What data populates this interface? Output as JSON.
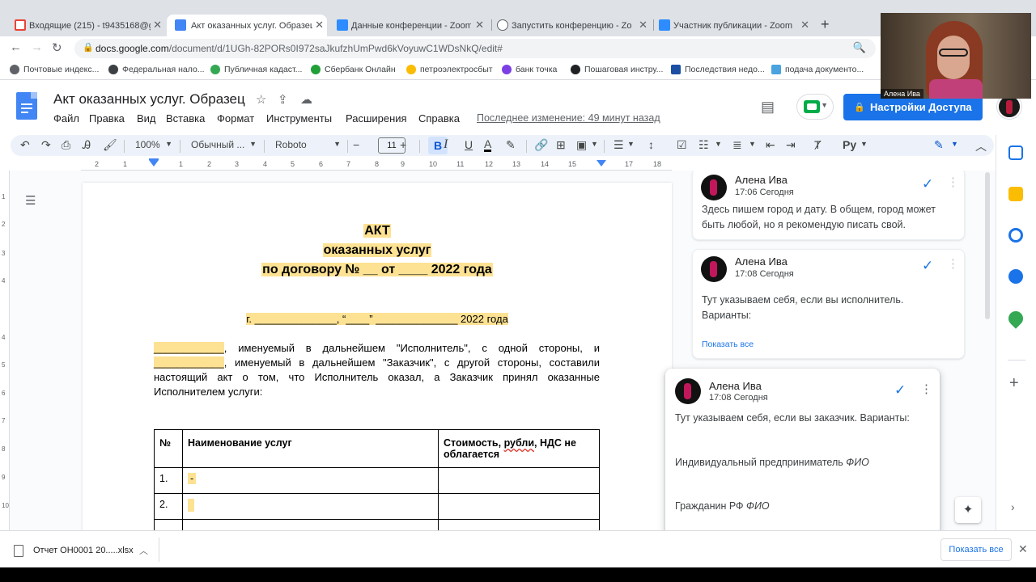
{
  "browser": {
    "tabs": [
      {
        "title": "Входящие (215) - t9435168@gm",
        "color": "#ea4335"
      },
      {
        "title": "Акт оказанных услуг. Образец",
        "color": "#4285f4"
      },
      {
        "title": "Данные конференции - Zoom",
        "color": "#2d8cff"
      },
      {
        "title": "Запустить конференцию - Zoom",
        "color": "#5f6368"
      },
      {
        "title": "Участник публикации - Zoom",
        "color": "#2d8cff"
      }
    ],
    "tab_close": "✕",
    "new_tab": "+",
    "url_host": "docs.google.com",
    "url_path": "/document/d/1UGh-82PORs0I972saJkufzhUmPwd6kVoyuwC1WDsNkQ/edit#",
    "bookmarks": [
      {
        "label": "Почтовые индекс...",
        "color": "#5f6368"
      },
      {
        "label": "Федеральная нало...",
        "color": "#3c4043"
      },
      {
        "label": "Публичная кадаст...",
        "color": "#34a853"
      },
      {
        "label": "Сбербанк Онлайн",
        "color": "#21a038"
      },
      {
        "label": "петроэлектросбыт",
        "color": "#fbbc04"
      },
      {
        "label": "банк точка",
        "color": "#7b3fe4"
      },
      {
        "label": "Пошаговая инстру...",
        "color": "#202124"
      },
      {
        "label": "Последствия недо...",
        "color": "#1a4fa3"
      },
      {
        "label": "подача документо...",
        "color": "#4aa3df"
      }
    ]
  },
  "docs": {
    "title": "Акт оказанных услуг. Образец",
    "menu": [
      "Файл",
      "Правка",
      "Вид",
      "Вставка",
      "Формат",
      "Инструменты",
      "Расширения",
      "Справка"
    ],
    "last_edit": "Последнее изменение: 49 минут назад",
    "share_label": "Настройки Доступа",
    "toolbar": {
      "zoom": "100%",
      "style": "Обычный ...",
      "font": "Roboto",
      "font_size": "11",
      "bold": "B",
      "italic": "I",
      "underline": "U",
      "text_color": "A"
    }
  },
  "ruler": {
    "marks": [
      "2",
      "1",
      "1",
      "2",
      "3",
      "4",
      "5",
      "6",
      "7",
      "8",
      "9",
      "10",
      "11",
      "12",
      "13",
      "14",
      "15",
      "16",
      "17",
      "18"
    ],
    "vmarks": [
      "1",
      "2",
      "3",
      "4",
      "5",
      "6",
      "7",
      "8",
      "9",
      "10"
    ]
  },
  "document": {
    "heading1": "АКТ",
    "heading2": "оказанных услуг",
    "heading3": "по договору № __ от ____ 2022 года",
    "city_line": "г. ______________, “____” ______________ 2022 года",
    "para_lines": [
      [
        "____________",
        ", именуемый в дальнейшем \"Исполнитель\", с одной стороны, и"
      ],
      [
        "____________",
        ", именуемый в дальнейшем \"Заказчик\", с другой стороны, составили"
      ],
      [
        "",
        "настоящий акт о том, что Исполнитель оказал, а Заказчик принял оказанные"
      ],
      [
        "",
        "Исполнителем услуги:"
      ]
    ],
    "table": {
      "headers": [
        "№",
        "Наименование услуг",
        "Стоимость, ",
        "рубли",
        ", НДС не облагается"
      ],
      "rows": [
        [
          "1.",
          "-",
          ""
        ],
        [
          "2.",
          "",
          ""
        ]
      ]
    }
  },
  "comments": [
    {
      "author": "Алена Ива",
      "time": "17:06 Сегодня",
      "lines": [
        "Здесь пишем город и дату. В общем, город может",
        "быть любой, но я рекомендую писать свой."
      ]
    },
    {
      "author": "Алена Ива",
      "time": "17:08 Сегодня",
      "lines": [
        "Тут указываем себя, если вы исполнитель.",
        "Варианты:"
      ],
      "show_all": "Показать все"
    },
    {
      "author": "Алена Ива",
      "time": "17:08 Сегодня",
      "lines": [
        "Тут указываем себя, если вы заказчик. Варианты:"
      ],
      "option1": "Индивидуальный предприниматель",
      "option2": "Гражданин РФ",
      "fio": "ФИО"
    }
  ],
  "download": {
    "file": "Отчет ОН0001 20.....xlsx",
    "show_all": "Показать все"
  },
  "video": {
    "name": "Алена Ива"
  },
  "colors": {
    "accent": "#1a73e8",
    "highlight": "#fde293",
    "toolbar_bg": "#edf2fa"
  }
}
